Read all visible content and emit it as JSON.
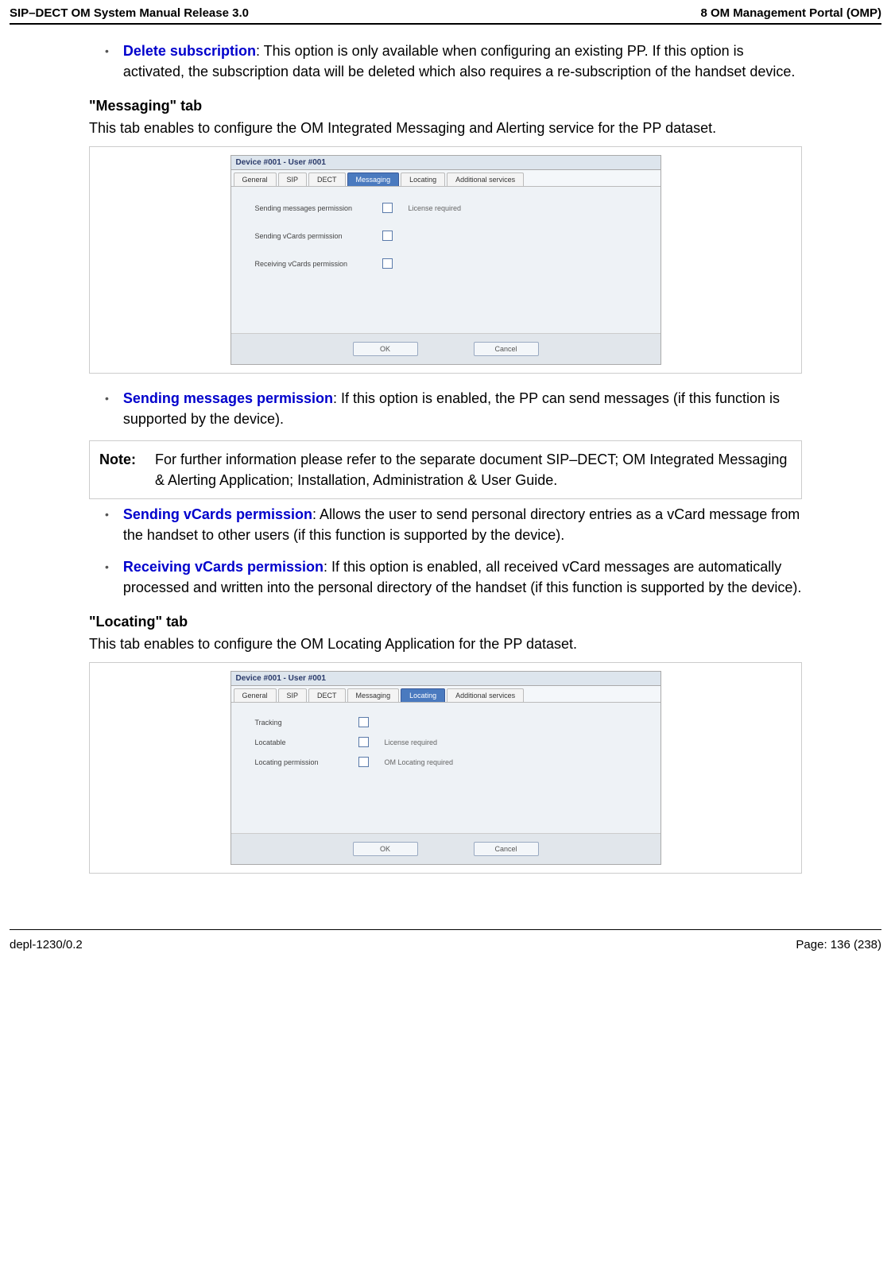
{
  "header": {
    "left": "SIP–DECT OM System Manual Release 3.0",
    "right": "8 OM Management Portal (OMP)"
  },
  "delete_sub": {
    "title": "Delete subscription",
    "text": ": This option is only available when configuring an existing PP. If this option is activated, the subscription data will be deleted which also requires a re-subscription of the handset device."
  },
  "messaging": {
    "heading": "\"Messaging\" tab",
    "para": "This tab enables to configure the OM Integrated Messaging and Alerting service for the PP dataset.",
    "dialog": {
      "title": "Device #001 - User #001",
      "tabs": [
        "General",
        "SIP",
        "DECT",
        "Messaging",
        "Locating",
        "Additional services"
      ],
      "active_tab": 3,
      "rows": [
        {
          "label": "Sending messages permission",
          "note": "License required"
        },
        {
          "label": "Sending vCards permission",
          "note": ""
        },
        {
          "label": "Receiving vCards permission",
          "note": ""
        }
      ],
      "ok": "OK",
      "cancel": "Cancel"
    }
  },
  "send_msg": {
    "title": "Sending messages permission",
    "text": ": If this option is enabled, the PP can send messages (if this function is supported by the device)."
  },
  "note": {
    "label": "Note:",
    "text": "For further information please refer to the separate document SIP–DECT; OM Integrated Messaging & Alerting Application; Installation, Administration & User Guide."
  },
  "send_vcard": {
    "title": "Sending vCards permission",
    "text": ": Allows the user to send personal directory entries as a vCard message from the handset to other users (if this function is supported by the device)."
  },
  "recv_vcard": {
    "title": "Receiving vCards permission",
    "text": ": If this option is enabled, all received vCard messages are automatically processed and written into the personal directory of the handset (if this function is supported by the device)."
  },
  "locating": {
    "heading": "\"Locating\" tab",
    "para": "This tab enables to configure the OM Locating Application for the PP dataset.",
    "dialog": {
      "title": "Device #001 - User #001",
      "tabs": [
        "General",
        "SIP",
        "DECT",
        "Messaging",
        "Locating",
        "Additional services"
      ],
      "active_tab": 4,
      "rows": [
        {
          "label": "Tracking",
          "note": ""
        },
        {
          "label": "Locatable",
          "note": "License required"
        },
        {
          "label": "Locating permission",
          "note": "OM Locating required"
        }
      ],
      "ok": "OK",
      "cancel": "Cancel"
    }
  },
  "footer": {
    "left": "depl-1230/0.2",
    "right": "Page: 136 (238)"
  }
}
